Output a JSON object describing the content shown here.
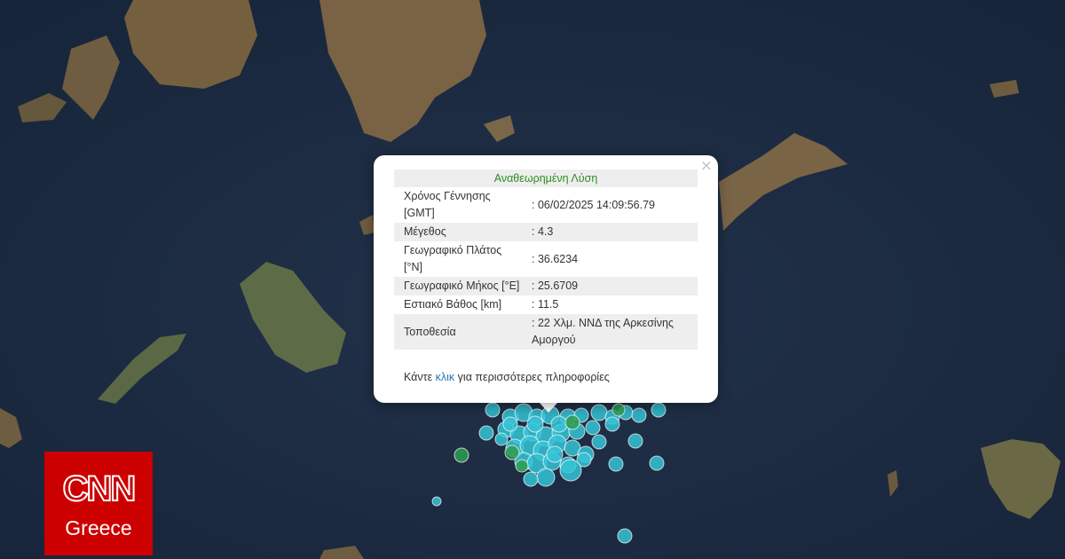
{
  "popup": {
    "header": "Αναθεωρημένη Λύση",
    "close_symbol": "×",
    "rows": [
      {
        "label": "Χρόνος Γέννησης [GMT]",
        "value": ": 06/02/2025 14:09:56.79"
      },
      {
        "label": "Μέγεθος",
        "value": ": 4.3"
      },
      {
        "label": "Γεωγραφικό Πλάτος [°N]",
        "value": ": 36.6234"
      },
      {
        "label": "Γεωγραφικό Μήκος [°E]",
        "value": ": 25.6709"
      },
      {
        "label": "Εστιακό Βάθος [km]",
        "value": ": 11.5"
      },
      {
        "label": "Τοποθεσία",
        "value": ": 22 Χλμ. ΝΝΔ της Αρκεσίνης Αμοργού"
      }
    ],
    "footer_before": "Κάντε ",
    "footer_link": "κλικ",
    "footer_after": " για περισσότερες πληροφορίες"
  },
  "logo": {
    "brand": "CNN",
    "edition": "Greece",
    "color": "#cc0000"
  },
  "colors": {
    "sea": "#1c2b3d",
    "quake_recent": "#35c4d6",
    "quake_older": "#2e9e52",
    "link": "#1f78b4"
  }
}
